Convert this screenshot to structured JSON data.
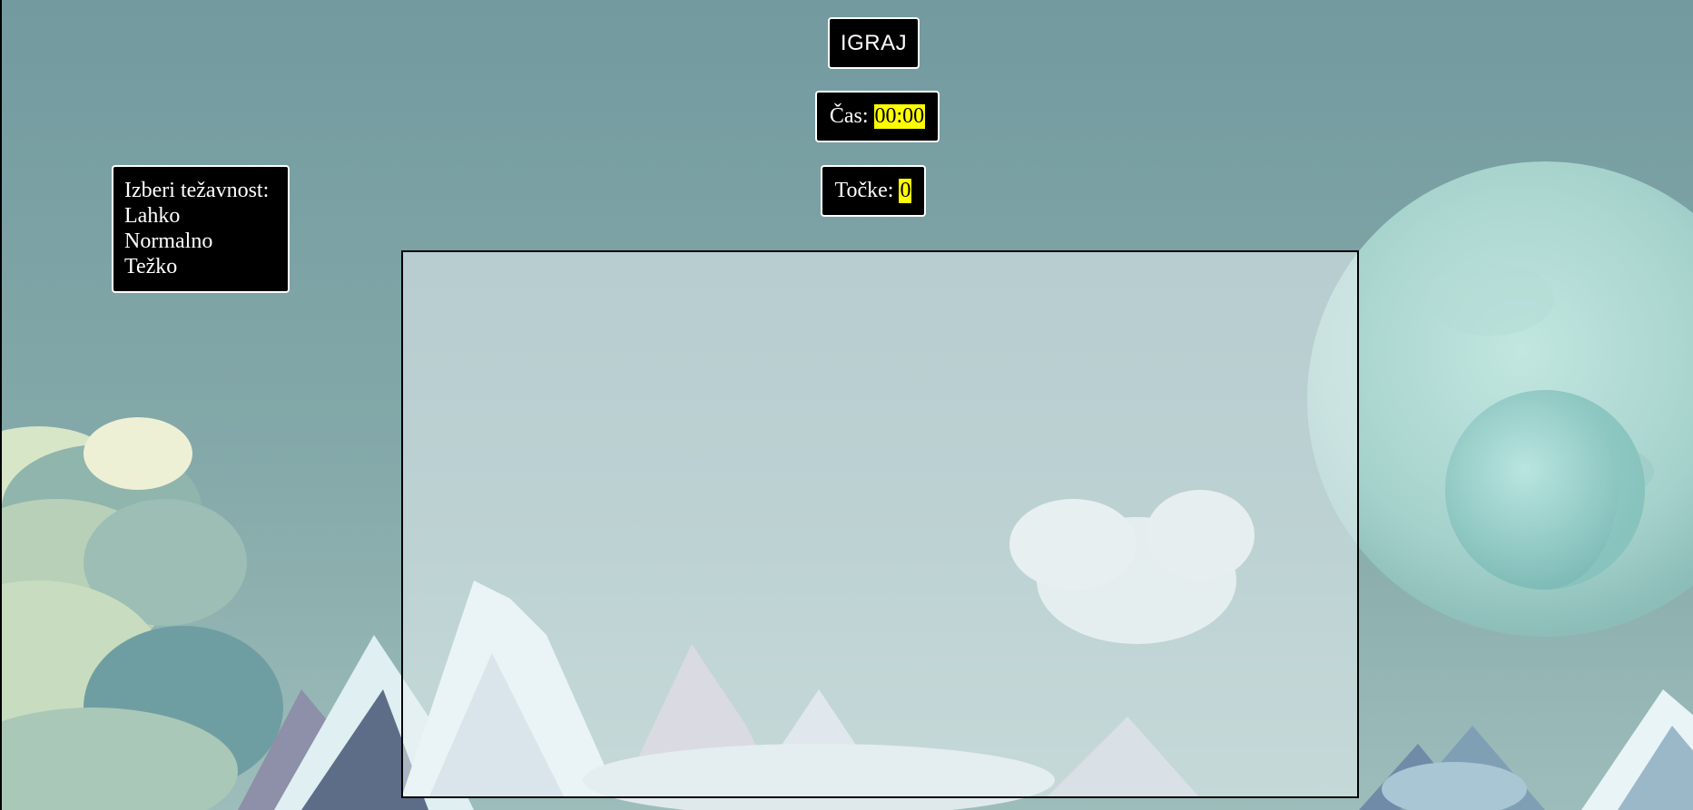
{
  "header": {
    "play_label": "IGRAJ"
  },
  "stats": {
    "time_label": "Čas:",
    "time_value": "00:00",
    "points_label": "Točke:",
    "points_value": "0"
  },
  "difficulty": {
    "title": "Izberi težavnost:",
    "options": [
      "Lahko",
      "Normalno",
      "Težko"
    ]
  },
  "colors": {
    "sky": "#7a9fa3",
    "box_background": "#000000",
    "box_text": "#ffffff",
    "highlight": "#ffff00",
    "planet": "#a8d4d0"
  }
}
